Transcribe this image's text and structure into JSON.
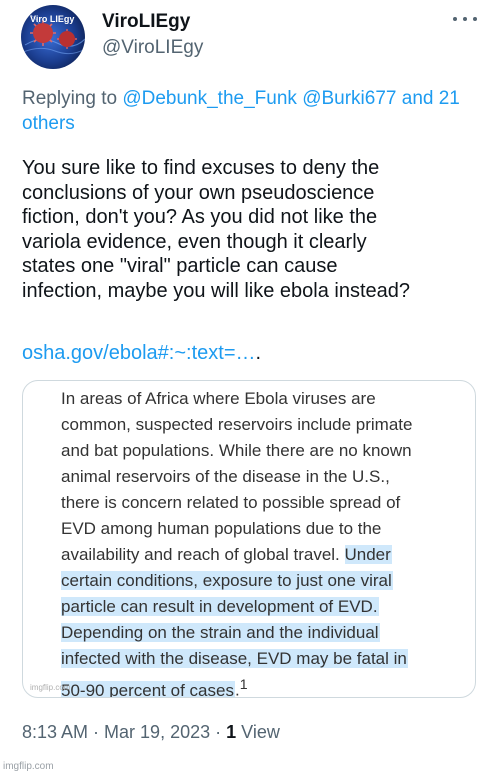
{
  "author": {
    "display_name": "ViroLIEgy",
    "handle": "@ViroLIEgy",
    "avatar_icon": "virus-globe-avatar-icon",
    "avatar_label": "Viro LIEgy"
  },
  "more_icon": "more-horizontal-icon",
  "reply": {
    "prefix": "Replying to ",
    "mentions": [
      "@Debunk_the_Funk",
      "@Burki677"
    ],
    "others": "and 21 others"
  },
  "tweet": {
    "lines": [
      "You sure like to find excuses to deny the",
      "conclusions of your own pseudoscience",
      "fiction, don't you? As you did not like the",
      "variola evidence, even though it clearly",
      "states one \"viral\" particle can cause",
      "infection, maybe you will like ebola instead?"
    ],
    "link_text": "osha.gov/ebola#:~:text=…",
    "link_tail": "."
  },
  "media": {
    "rows": [
      {
        "plain": "In areas of Africa where Ebola viruses are",
        "highlight": ""
      },
      {
        "plain": "common, suspected reservoirs include primate",
        "highlight": ""
      },
      {
        "plain": "and bat populations. While there are no known",
        "highlight": ""
      },
      {
        "plain": "animal reservoirs of the disease in the U.S.,",
        "highlight": ""
      },
      {
        "plain": "there is concern related to possible spread of",
        "highlight": ""
      },
      {
        "plain": "EVD among human populations due to the",
        "highlight": ""
      },
      {
        "plain": "availability and reach of global travel. ",
        "highlight": "Under"
      },
      {
        "plain": "",
        "highlight": "certain conditions, exposure to just one viral"
      },
      {
        "plain": "",
        "highlight": "particle can result in development of EVD."
      },
      {
        "plain": "",
        "highlight": "Depending on the strain and the individual"
      },
      {
        "plain": "",
        "highlight": "infected with the disease, EVD may be fatal in"
      },
      {
        "plain": "",
        "highlight": "50-90 percent of cases",
        "tail": ".",
        "sup": "1"
      }
    ],
    "watermark": "imgflip.com"
  },
  "meta": {
    "time": "8:13 AM",
    "sep1": " · ",
    "date": "Mar 19, 2023",
    "sep2": " · ",
    "views_count": "1",
    "views_label": " View"
  },
  "footer_watermark": "imgflip.com",
  "colors": {
    "link": "#1d9bf0",
    "secondary": "#536471",
    "highlight": "#cfe8fb",
    "text": "#0f1419"
  }
}
